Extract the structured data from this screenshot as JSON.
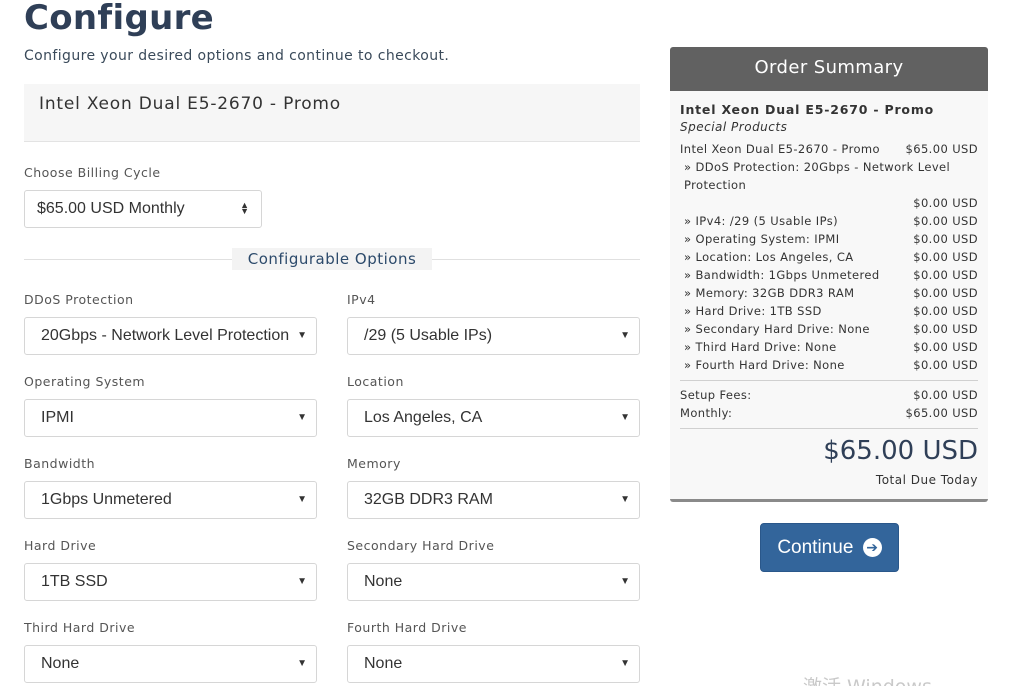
{
  "header": {
    "title": "Configure",
    "subtitle": "Configure your desired options and continue to checkout."
  },
  "product": {
    "name": "Intel Xeon Dual E5-2670 - Promo"
  },
  "billing": {
    "label": "Choose Billing Cycle",
    "value": "$65.00 USD Monthly"
  },
  "section_title": "Configurable Options",
  "options": {
    "ddos": {
      "label": "DDoS Protection",
      "value": "20Gbps - Network Level Protection"
    },
    "ipv4": {
      "label": "IPv4",
      "value": "/29 (5 Usable IPs)"
    },
    "os": {
      "label": "Operating System",
      "value": "IPMI"
    },
    "location": {
      "label": "Location",
      "value": "Los Angeles, CA"
    },
    "bandwidth": {
      "label": "Bandwidth",
      "value": "1Gbps Unmetered"
    },
    "memory": {
      "label": "Memory",
      "value": "32GB DDR3 RAM"
    },
    "hard_drive": {
      "label": "Hard Drive",
      "value": "1TB SSD"
    },
    "secondary_drive": {
      "label": "Secondary Hard Drive",
      "value": "None"
    },
    "third_drive": {
      "label": "Third Hard Drive",
      "value": "None"
    },
    "fourth_drive": {
      "label": "Fourth Hard Drive",
      "value": "None"
    }
  },
  "summary": {
    "title": "Order Summary",
    "product": "Intel Xeon Dual E5-2670 - Promo",
    "group": "Special Products",
    "base_label": "Intel Xeon Dual E5-2670 - Promo",
    "base_price": "$65.00 USD",
    "ddos_line": "» DDoS Protection: 20Gbps - Network Level Protection",
    "ddos_price": "$0.00 USD",
    "items": [
      {
        "label": "» IPv4: /29 (5 Usable IPs)",
        "price": "$0.00 USD"
      },
      {
        "label": "» Operating System: IPMI",
        "price": "$0.00 USD"
      },
      {
        "label": "» Location: Los Angeles, CA",
        "price": "$0.00 USD"
      },
      {
        "label": "» Bandwidth: 1Gbps Unmetered",
        "price": "$0.00 USD"
      },
      {
        "label": "» Memory: 32GB DDR3 RAM",
        "price": "$0.00 USD"
      },
      {
        "label": "» Hard Drive: 1TB SSD",
        "price": "$0.00 USD"
      },
      {
        "label": "» Secondary Hard Drive: None",
        "price": "$0.00 USD"
      },
      {
        "label": "» Third Hard Drive: None",
        "price": "$0.00 USD"
      },
      {
        "label": "» Fourth Hard Drive: None",
        "price": "$0.00 USD"
      }
    ],
    "setup_label": "Setup Fees:",
    "setup_value": "$0.00 USD",
    "monthly_label": "Monthly:",
    "monthly_value": "$65.00 USD",
    "total": "$65.00 USD",
    "total_label": "Total Due Today"
  },
  "continue_label": "Continue",
  "watermark_text": "激活 Windows",
  "colors": {
    "accent": "#33659b",
    "title": "#2f3f57",
    "summary_header": "#616161"
  }
}
